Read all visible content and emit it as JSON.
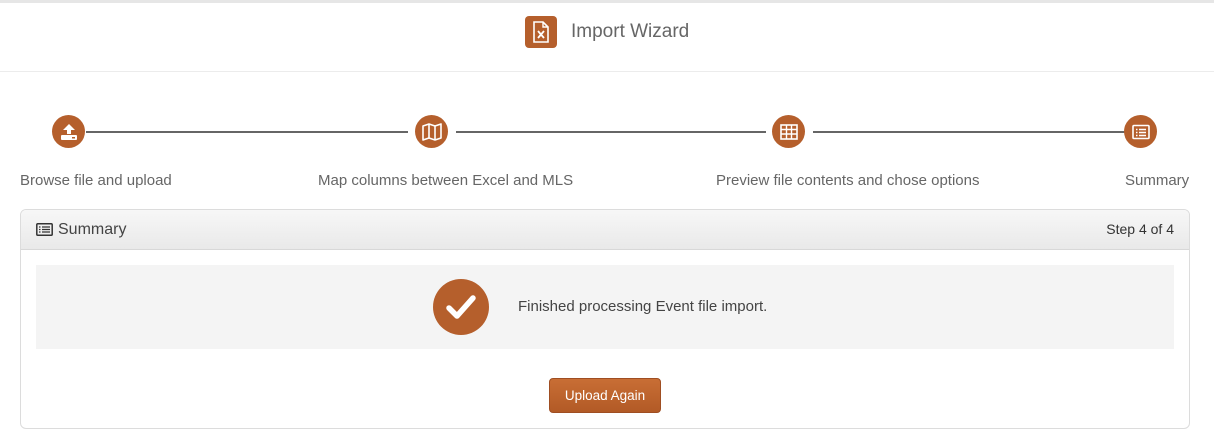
{
  "header": {
    "title": "Import Wizard",
    "icon": "excel-file-icon"
  },
  "wizard": {
    "steps": [
      {
        "label": "Browse file and upload",
        "icon": "upload-icon"
      },
      {
        "label": "Map columns between Excel and MLS",
        "icon": "map-icon"
      },
      {
        "label": "Preview file contents and chose options",
        "icon": "table-icon"
      },
      {
        "label": "Summary",
        "icon": "list-alt-icon"
      }
    ]
  },
  "panel": {
    "title": "Summary",
    "title_icon": "list-alt-icon",
    "step_text": "Step 4 of 4",
    "message": "Finished processing Event file import.",
    "message_icon": "check-icon",
    "button_label": "Upload Again"
  },
  "colors": {
    "accent": "#b55f2c",
    "message_bg": "#f4f4f4"
  }
}
